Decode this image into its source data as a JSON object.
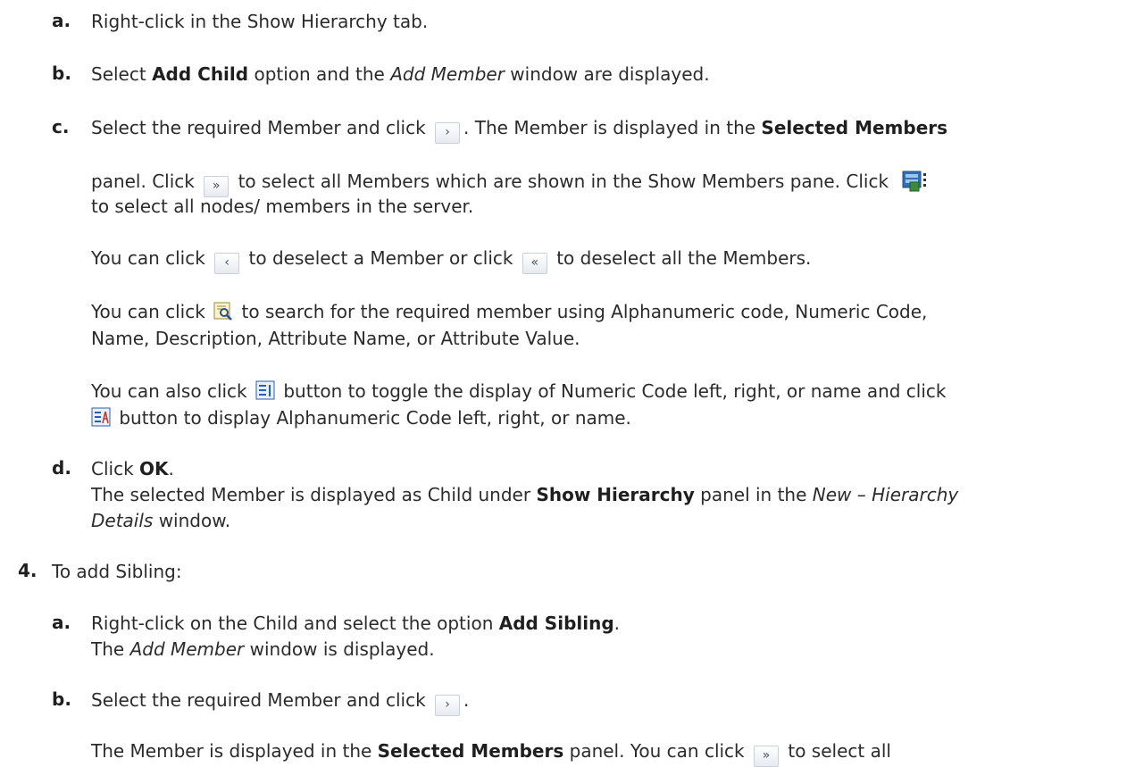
{
  "steps": {
    "a1": {
      "marker": "a.",
      "text": "Right-click in the Show Hierarchy tab."
    },
    "b1": {
      "marker": "b.",
      "t1": "Select ",
      "bold1": "Add Child",
      "t2": " option and the ",
      "ital1": "Add Member",
      "t3": " window are displayed."
    },
    "c1": {
      "marker": "c.",
      "l1a": "Select the required Member and click ",
      "l1b": ". The Member is displayed in the ",
      "l1bold": "Selected Members",
      "l2a": "panel. Click ",
      "l2b": " to select all Members which are shown in the Show Members pane. Click",
      "l3": "to select all nodes/ members in the server.",
      "p2a": "You can click ",
      "p2b": " to deselect a Member or click ",
      "p2c": " to deselect all the Members.",
      "p3a": "You can click ",
      "p3b": " to search for the required member using Alphanumeric code, Numeric Code,",
      "p3c": "Name, Description, Attribute Name, or Attribute Value.",
      "p4a": "You can also click ",
      "p4b": " button to toggle the display of Numeric Code left, right, or name and click",
      "p4c": " button to display Alphanumeric Code left, right, or name."
    },
    "d1": {
      "marker": "d.",
      "t1": "Click ",
      "bold1": "OK",
      "t2": ".",
      "l2a": "The selected Member is displayed as Child under ",
      "l2bold": "Show Hierarchy",
      "l2b": " panel in the ",
      "l2ital": "New – Hierarchy",
      "l3ital": "Details",
      "l3b": " window."
    },
    "s4": {
      "marker": "4.",
      "text": "To add Sibling:"
    },
    "a2": {
      "marker": "a.",
      "t1": "Right-click on the Child and select the option ",
      "bold1": "Add Sibling",
      "t2": ".",
      "l2a": "The ",
      "l2ital": "Add Member",
      "l2b": " window is displayed."
    },
    "b2": {
      "marker": "b.",
      "t1": "Select the required Member and click ",
      "t2": ".",
      "l2a": "The Member is displayed in the ",
      "l2bold": "Selected Members",
      "l2b": " panel. You can click ",
      "l2c": " to select all"
    }
  },
  "buttons": {
    "select_one": "›",
    "select_all": "»",
    "deselect_one": "‹",
    "deselect_all": "«"
  },
  "icons": [
    "select-all-server-icon",
    "search-icon",
    "numeric-code-toggle-icon",
    "alphanumeric-code-toggle-icon"
  ]
}
